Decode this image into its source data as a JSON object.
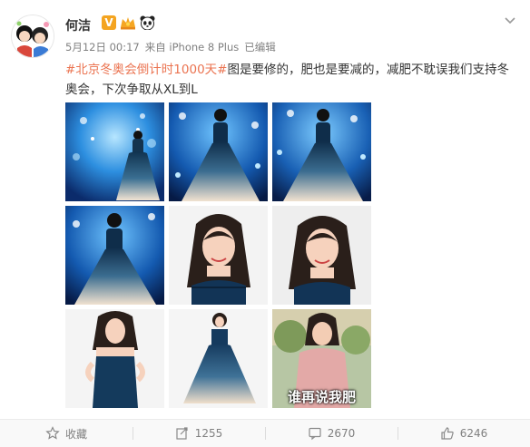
{
  "user": {
    "name": "何洁"
  },
  "meta": {
    "time": "5月12日 00:17",
    "source": "来自 iPhone 8 Plus",
    "edited": "已编辑"
  },
  "post": {
    "topic": "#北京冬奥会倒计时1000天#",
    "line1_rest": "图是要修的，肥也是要减的，减肥不耽误我们支持冬",
    "line2": "奥会，下次争取从XL到L"
  },
  "images": {
    "caption_last": "谁再说我肥"
  },
  "footer": {
    "favorite": "收藏",
    "repost": "1255",
    "comment": "2670",
    "like": "6246"
  },
  "colors": {
    "topic": "#eb7350",
    "verified": "#f4a420"
  },
  "icons": [
    "verified-v-icon",
    "vip-crown-icon",
    "panda-icon",
    "chevron-down-icon",
    "star-icon",
    "repost-icon",
    "comment-icon",
    "like-icon"
  ]
}
